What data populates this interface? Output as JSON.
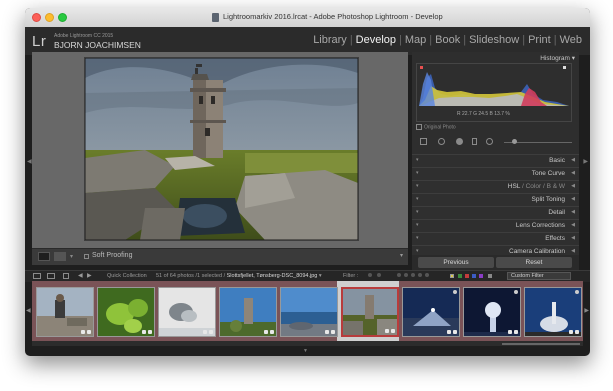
{
  "window": {
    "title": "Lightroomarkiv 2016.lrcat - Adobe Photoshop Lightroom - Develop"
  },
  "identity": {
    "logo": "Lr",
    "app_name": "Adobe Lightroom CC 2015",
    "user_name": "BJORN JOACHIMSEN"
  },
  "modules": {
    "items": [
      "Library",
      "Develop",
      "Map",
      "Book",
      "Slideshow",
      "Print",
      "Web"
    ],
    "active": "Develop",
    "separator": "|"
  },
  "toolbar": {
    "soft_proofing_label": "Soft Proofing"
  },
  "right_panel": {
    "histogram": {
      "title": "Histogram",
      "readout": "R  22.7   G  24.5   B  13.7 %",
      "original_photo_label": "Original Photo"
    },
    "panels": [
      {
        "label": "Basic"
      },
      {
        "label": "Tone Curve"
      },
      {
        "label": "HSL",
        "sep1": "/",
        "label2": "Color",
        "sep2": "/",
        "label3": "B & W"
      },
      {
        "label": "Split Toning"
      },
      {
        "label": "Detail"
      },
      {
        "label": "Lens Corrections"
      },
      {
        "label": "Effects"
      },
      {
        "label": "Camera Calibration"
      }
    ],
    "buttons": {
      "previous": "Previous",
      "reset": "Reset"
    }
  },
  "filmstrip_bar": {
    "collection_label": "Quick Collection",
    "count_text": "51 of 64 photos /1 selected /",
    "selected_file": "Slottsfjellet, Tønsberg-DSC_8094.jpg",
    "filter_label": "Filter :",
    "custom_filter": "Custom Filter"
  },
  "filmstrip": {
    "thumbnails": [
      {
        "subject": "person-on-rocks"
      },
      {
        "subject": "green-leaves"
      },
      {
        "subject": "white-rock-closeup"
      },
      {
        "subject": "tower-blue-sky"
      },
      {
        "subject": "sea-and-rocks"
      },
      {
        "subject": "tower-selected",
        "selected": true
      },
      {
        "subject": "night-harbor"
      },
      {
        "subject": "tree-night-sky"
      },
      {
        "subject": "telescope-night"
      }
    ]
  },
  "colors": {
    "window_bg": "#1e1e1e",
    "center_bg": "#686868",
    "panel_bg": "#2e2e2e",
    "filmstrip_highlight": "#7a5357",
    "selected_frame": "#c9c9c9"
  }
}
